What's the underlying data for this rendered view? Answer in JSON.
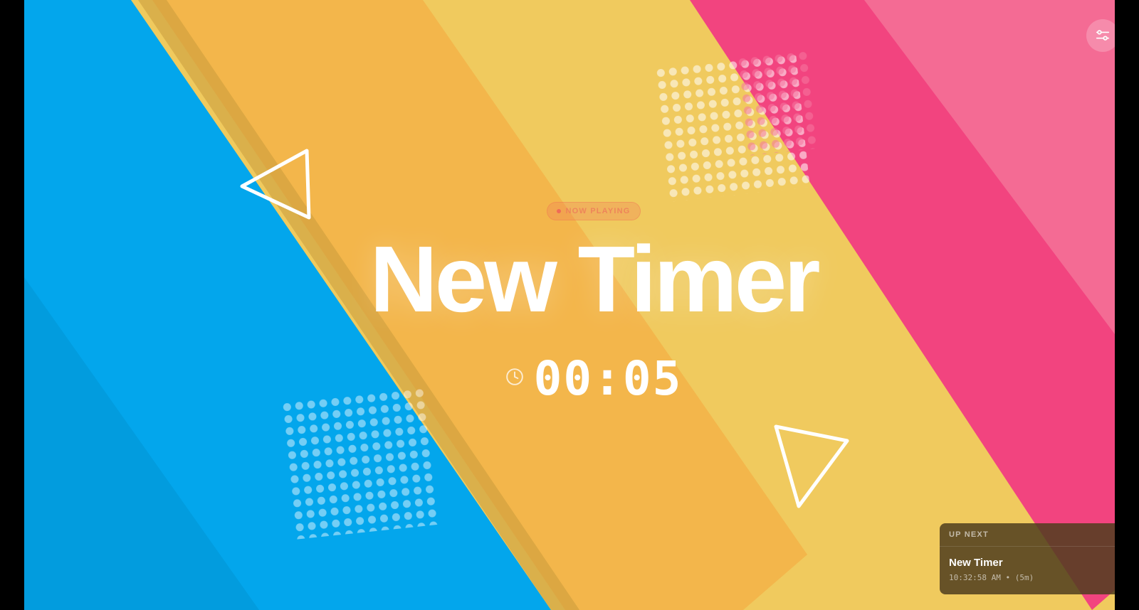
{
  "colors": {
    "blue": "#03a6ec",
    "orange": "#f3b64b",
    "yellow": "#f0ca5e",
    "pink": "#f2447f",
    "light_pink": "#f46b94",
    "accent": "#ef6b57"
  },
  "header": {
    "settings_icon": "sliders-icon"
  },
  "status": {
    "label": "NOW PLAYING"
  },
  "current": {
    "title": "New Timer",
    "clock_icon": "clock-icon",
    "remaining": "00:05"
  },
  "up_next": {
    "heading": "UP NEXT",
    "title": "New Timer",
    "meta": "10:32:58 AM • (5m)"
  }
}
